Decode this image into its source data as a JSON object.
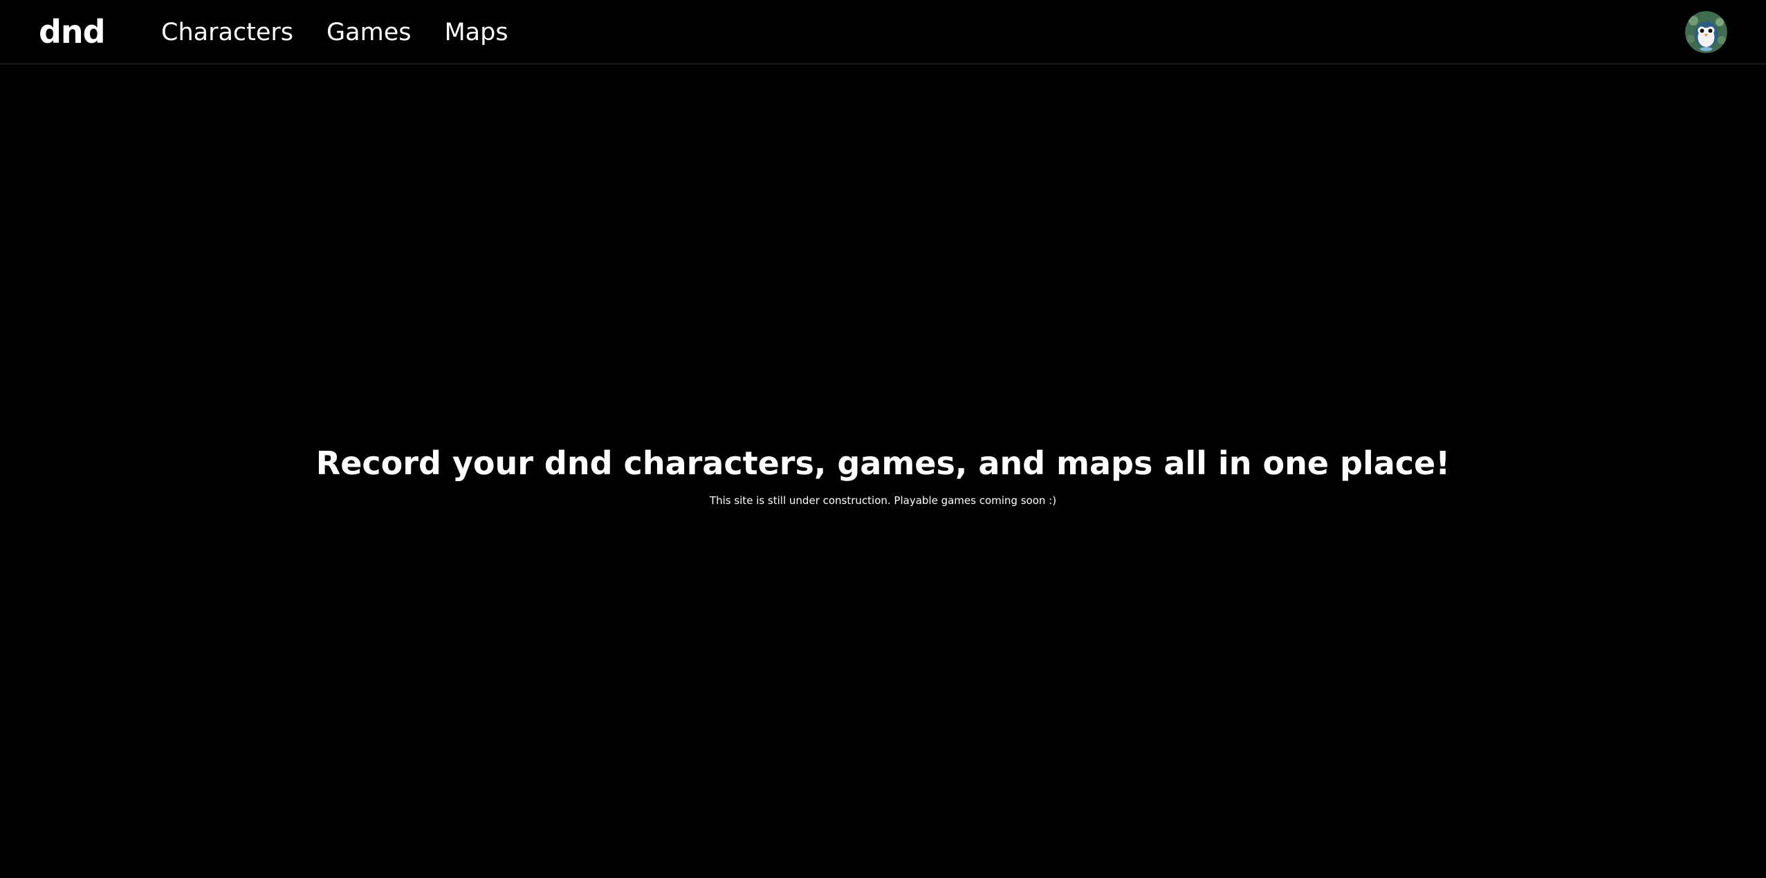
{
  "navbar": {
    "brand": "dnd",
    "links": [
      {
        "label": "Characters"
      },
      {
        "label": "Games"
      },
      {
        "label": "Maps"
      }
    ],
    "avatar": {
      "icon": "penguin-avatar-icon"
    }
  },
  "hero": {
    "title": "Record your dnd characters, games, and maps all in one place!",
    "subtitle": "This site is still under construction. Playable games coming soon :)"
  },
  "colors": {
    "background": "#000000",
    "text": "#ffffff",
    "divider": "#2a2a2a"
  }
}
